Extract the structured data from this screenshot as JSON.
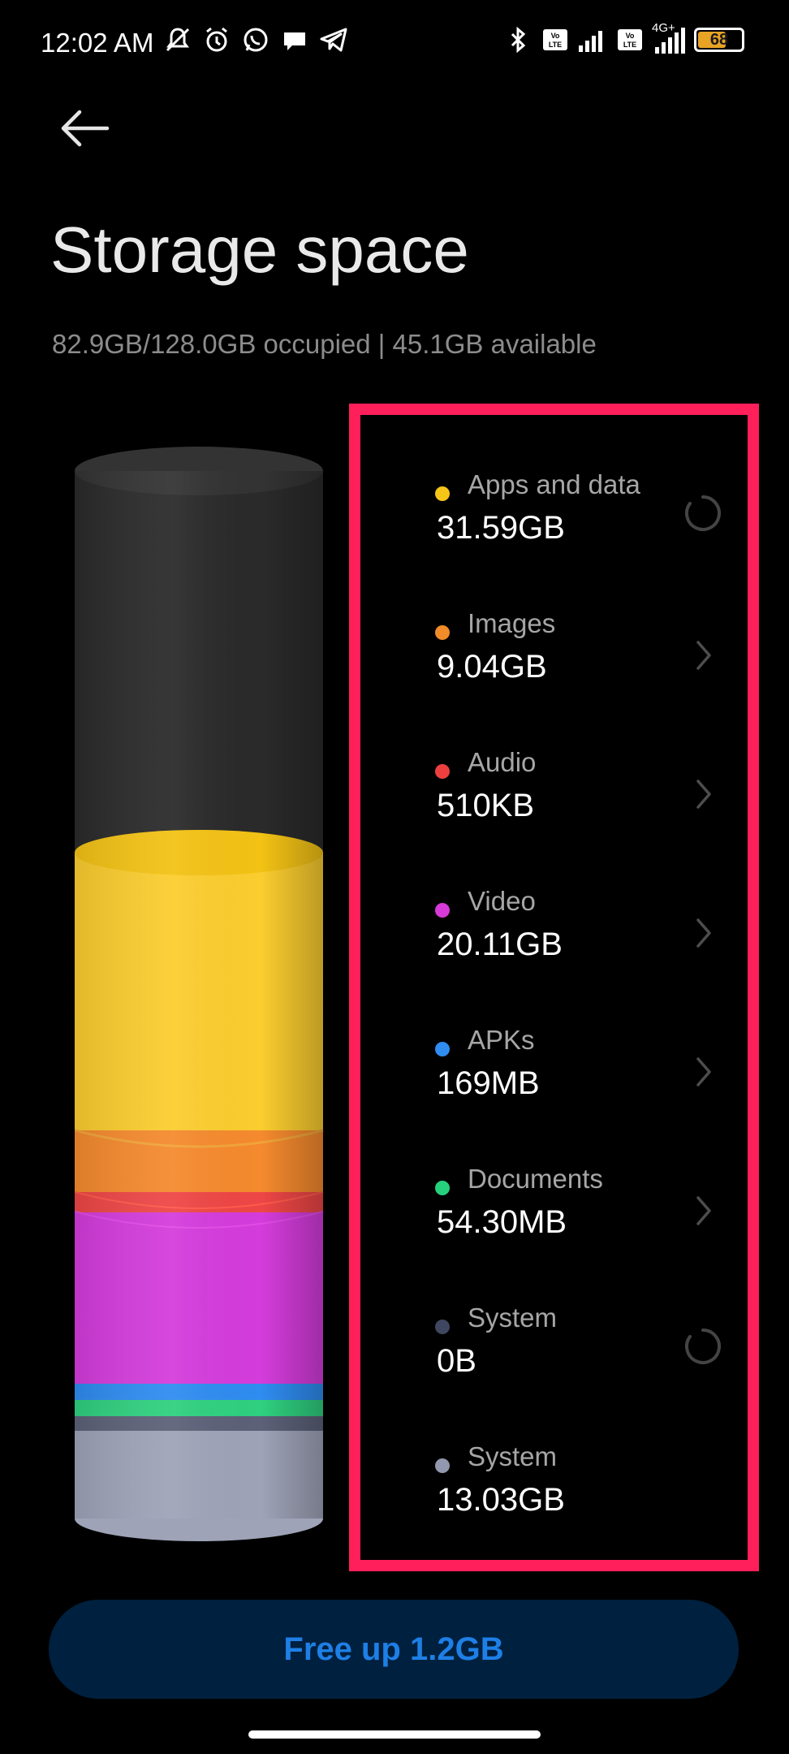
{
  "status_bar": {
    "time": "12:02 AM",
    "battery_level": 68,
    "network_label": "4G+"
  },
  "header": {
    "title": "Storage space",
    "summary": "82.9GB/128.0GB occupied | 45.1GB available"
  },
  "categories": [
    {
      "label": "Apps and data",
      "value": "31.59GB",
      "color": "#f5c518",
      "action": "spinner"
    },
    {
      "label": "Images",
      "value": "9.04GB",
      "color": "#f28c28",
      "action": "chevron"
    },
    {
      "label": "Audio",
      "value": "510KB",
      "color": "#ee3f3f",
      "action": "chevron"
    },
    {
      "label": "Video",
      "value": "20.11GB",
      "color": "#d63ad8",
      "action": "chevron"
    },
    {
      "label": "APKs",
      "value": "169MB",
      "color": "#2f8cf0",
      "action": "chevron"
    },
    {
      "label": "Documents",
      "value": "54.30MB",
      "color": "#26d07c",
      "action": "chevron"
    },
    {
      "label": "System",
      "value": "0B",
      "color": "#3f4660",
      "action": "spinner"
    },
    {
      "label": "System",
      "value": "13.03GB",
      "color": "#9298ad",
      "action": "none"
    }
  ],
  "free_up_button": {
    "label": "Free up 1.2GB"
  }
}
